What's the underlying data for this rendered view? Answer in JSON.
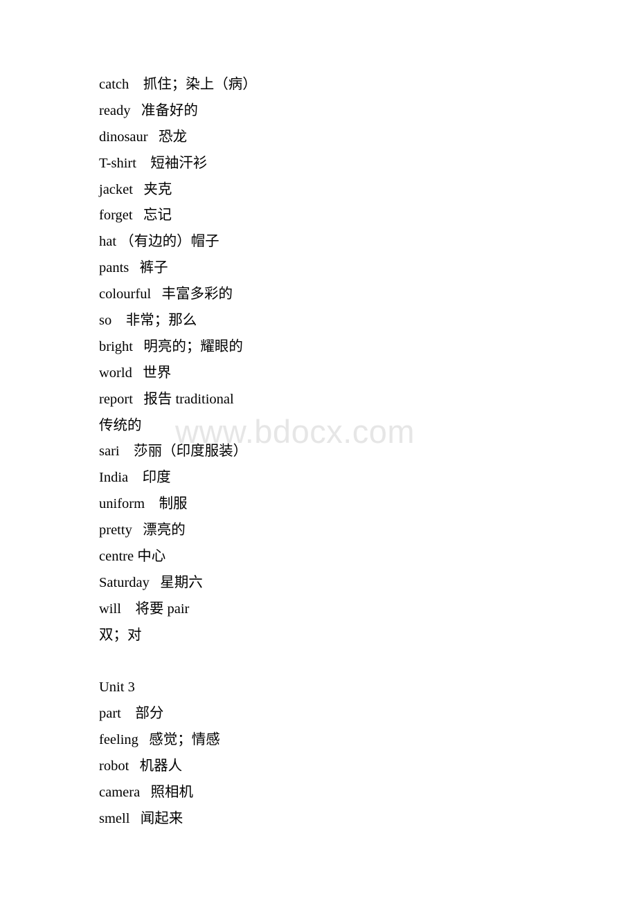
{
  "document": {
    "type": "vocabulary-list",
    "language_pair": "English-Chinese",
    "watermark": {
      "text": "www.bdocx.com",
      "color": "#e6e6e6"
    },
    "text_color": "#000000",
    "background_color": "#ffffff",
    "lines": [
      {
        "id": "line-catch",
        "kind": "entry",
        "text": "catch    抓住；染上（病）"
      },
      {
        "id": "line-ready",
        "kind": "entry",
        "text": "ready   准备好的"
      },
      {
        "id": "line-dinosaur",
        "kind": "entry",
        "text": "dinosaur   恐龙"
      },
      {
        "id": "line-tshirt",
        "kind": "entry",
        "text": "T-shirt    短袖汗衫"
      },
      {
        "id": "line-jacket",
        "kind": "entry",
        "text": "jacket   夹克"
      },
      {
        "id": "line-forget",
        "kind": "entry",
        "text": "forget   忘记"
      },
      {
        "id": "line-hat",
        "kind": "entry",
        "text": "hat （有边的）帽子"
      },
      {
        "id": "line-pants",
        "kind": "entry",
        "text": "pants   裤子"
      },
      {
        "id": "line-colourful",
        "kind": "entry",
        "text": "colourful   丰富多彩的"
      },
      {
        "id": "line-so",
        "kind": "entry",
        "text": "so    非常；那么"
      },
      {
        "id": "line-bright",
        "kind": "entry",
        "text": "bright   明亮的；耀眼的"
      },
      {
        "id": "line-world",
        "kind": "entry",
        "text": "world   世界"
      },
      {
        "id": "line-report",
        "kind": "entry",
        "text": "report   报告 traditional"
      },
      {
        "id": "line-traditional-cont",
        "kind": "continuation",
        "text": "传统的"
      },
      {
        "id": "line-sari",
        "kind": "entry",
        "text": "sari    莎丽（印度服装）"
      },
      {
        "id": "line-india",
        "kind": "entry",
        "text": "India    印度"
      },
      {
        "id": "line-uniform",
        "kind": "entry",
        "text": "uniform    制服"
      },
      {
        "id": "line-pretty",
        "kind": "entry",
        "text": "pretty   漂亮的"
      },
      {
        "id": "line-centre",
        "kind": "entry",
        "text": "centre 中心"
      },
      {
        "id": "line-saturday",
        "kind": "entry",
        "text": "Saturday   星期六"
      },
      {
        "id": "line-will",
        "kind": "entry",
        "text": "will    将要 pair"
      },
      {
        "id": "line-pair-cont",
        "kind": "continuation",
        "text": "双；对"
      },
      {
        "id": "line-gap-1",
        "kind": "blank",
        "text": ""
      },
      {
        "id": "line-unit3",
        "kind": "heading",
        "text": "Unit 3"
      },
      {
        "id": "line-part",
        "kind": "entry",
        "text": "part    部分"
      },
      {
        "id": "line-feeling",
        "kind": "entry",
        "text": "feeling   感觉；情感"
      },
      {
        "id": "line-robot",
        "kind": "entry",
        "text": "robot   机器人"
      },
      {
        "id": "line-camera",
        "kind": "entry",
        "text": "camera   照相机"
      },
      {
        "id": "line-smell",
        "kind": "entry",
        "text": "smell   闻起来"
      }
    ]
  }
}
